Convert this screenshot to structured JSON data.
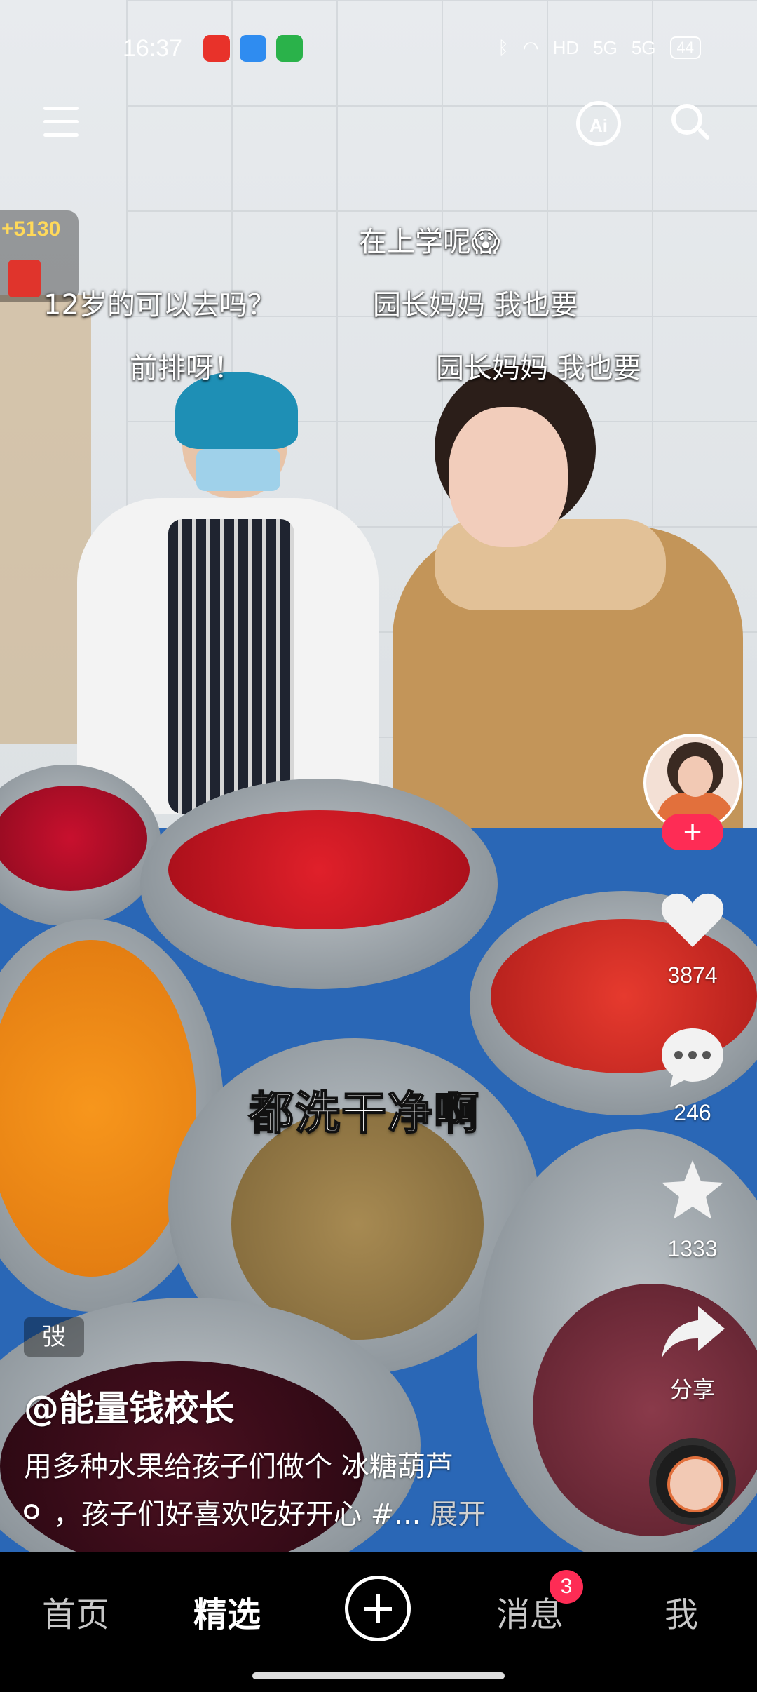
{
  "status_bar": {
    "time": "16:37",
    "hd": "HD",
    "net1": "5G",
    "net2": "5G",
    "battery": "44"
  },
  "colors": {
    "accent": "#fe2c55",
    "coins": "#ffd95a"
  },
  "top_bar": {
    "menu_icon": "menu-icon",
    "ai_label": "Ai",
    "search_icon": "search-icon"
  },
  "red_packet": {
    "coins": "+5130"
  },
  "danmaku": [
    {
      "text": "在上学呢😱"
    },
    {
      "text": "12岁的可以去吗？"
    },
    {
      "text": "园长妈妈 我也要"
    },
    {
      "text": "前排呀！"
    },
    {
      "text": "园长妈妈 我也要"
    }
  ],
  "subtitle": "都洗干净啊",
  "actions": {
    "likes": "3874",
    "comments": "246",
    "favorites": "1333",
    "share": "分享"
  },
  "video_info": {
    "tag": "弢",
    "author": "@能量钱校长",
    "desc_line1": "用多种水果给孩子们做个 冰糖葫芦",
    "desc_line2": "，孩子们好喜欢吃好开心 #...",
    "expand": "展开"
  },
  "bottom_nav": {
    "home": "首页",
    "featured": "精选",
    "messages": "消息",
    "messages_badge": "3",
    "me": "我"
  }
}
